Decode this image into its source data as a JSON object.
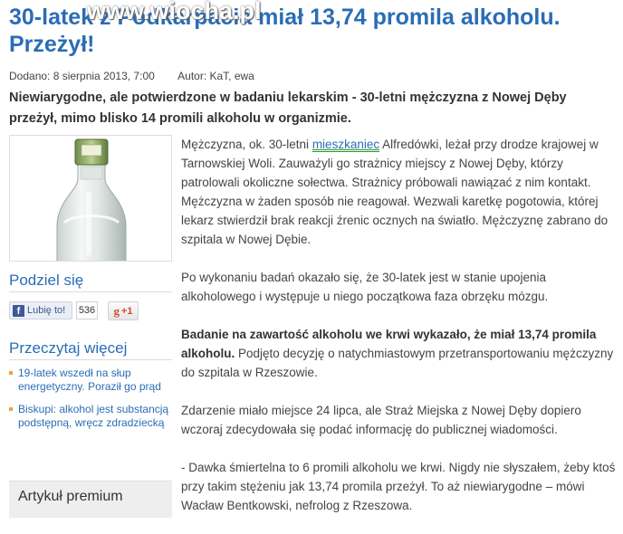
{
  "article": {
    "title": "30-latek z Podkarpacia miał 13,74 promila alkoholu. Przeżył!",
    "watermark": "www.wiocha.pl",
    "meta": {
      "date": "Dodano: 8 sierpnia 2013, 7:00",
      "author": "Autor: KaT, ewa"
    },
    "lead": "Niewiarygodne, ale potwierdzone w badaniu lekarskim - 30-letni mężczyzna z Nowej Dęby przeżył, mimo blisko 14 promili alkoholu w organizmie.",
    "paragraphs": {
      "p1_before": "Mężczyzna, ok. 30-letni ",
      "p1_link": "mieszkaniec",
      "p1_after": " Alfredówki, leżał przy drodze krajowej w Tarnowskiej Woli. Zauważyli go strażnicy miejscy z Nowej Dęby, którzy patrolowali okoliczne sołectwa. Strażnicy próbowali nawiązać z nim kontakt. Mężczyzna w żaden sposób nie reagował. Wezwali karetkę pogotowia, której lekarz stwierdził brak reakcji źrenic ocznych na światło. Mężczyznę zabrano do szpitala w Nowej Dębie.",
      "p2": "Po wykonaniu badań okazało się, że 30-latek jest w stanie upojenia alkoholowego i występuje u niego początkowa faza obrzęku mózgu.",
      "p3_bold": "Badanie na zawartość alkoholu we krwi wykazało, że miał 13,74 promila alkoholu.",
      "p3_rest": " Podjęto decyzję o natychmiastowym przetransportowaniu mężczyzny do szpitala w Rzeszowie.",
      "p4": "Zdarzenie miało miejsce 24 lipca, ale Straż Miejska z Nowej Dęby dopiero wczoraj zdecydowała się podać informację do publicznej wiadomości.",
      "p5": "- Dawka śmiertelna to 6 promili alkoholu we krwi. Nigdy nie słyszałem, żeby ktoś przy takim stężeniu jak 13,74 promila przeżył. To aż niewiarygodne – mówi Wacław Bentkowski, nefrolog z Rzeszowa."
    }
  },
  "sidebar": {
    "share": {
      "heading": "Podziel się",
      "fb_label": "Lubię to!",
      "fb_count": "536",
      "gplus_label": "+1"
    },
    "more": {
      "heading": "Przeczytaj więcej",
      "items": [
        "19-latek wszedł na słup energetyczny. Poraził go prąd",
        "Biskupi: alkohol jest substancją podstępną, wręcz zdradziecką"
      ]
    },
    "premium": {
      "heading": "Artykuł premium"
    }
  },
  "colors": {
    "title": "#2a6db5",
    "link": "#2a6db5",
    "bullet": "#e9a23b",
    "facebook": "#3b5998",
    "gplus": "#d14836"
  },
  "icons": [
    "bottle-photo",
    "facebook-icon",
    "gplus-icon"
  ]
}
